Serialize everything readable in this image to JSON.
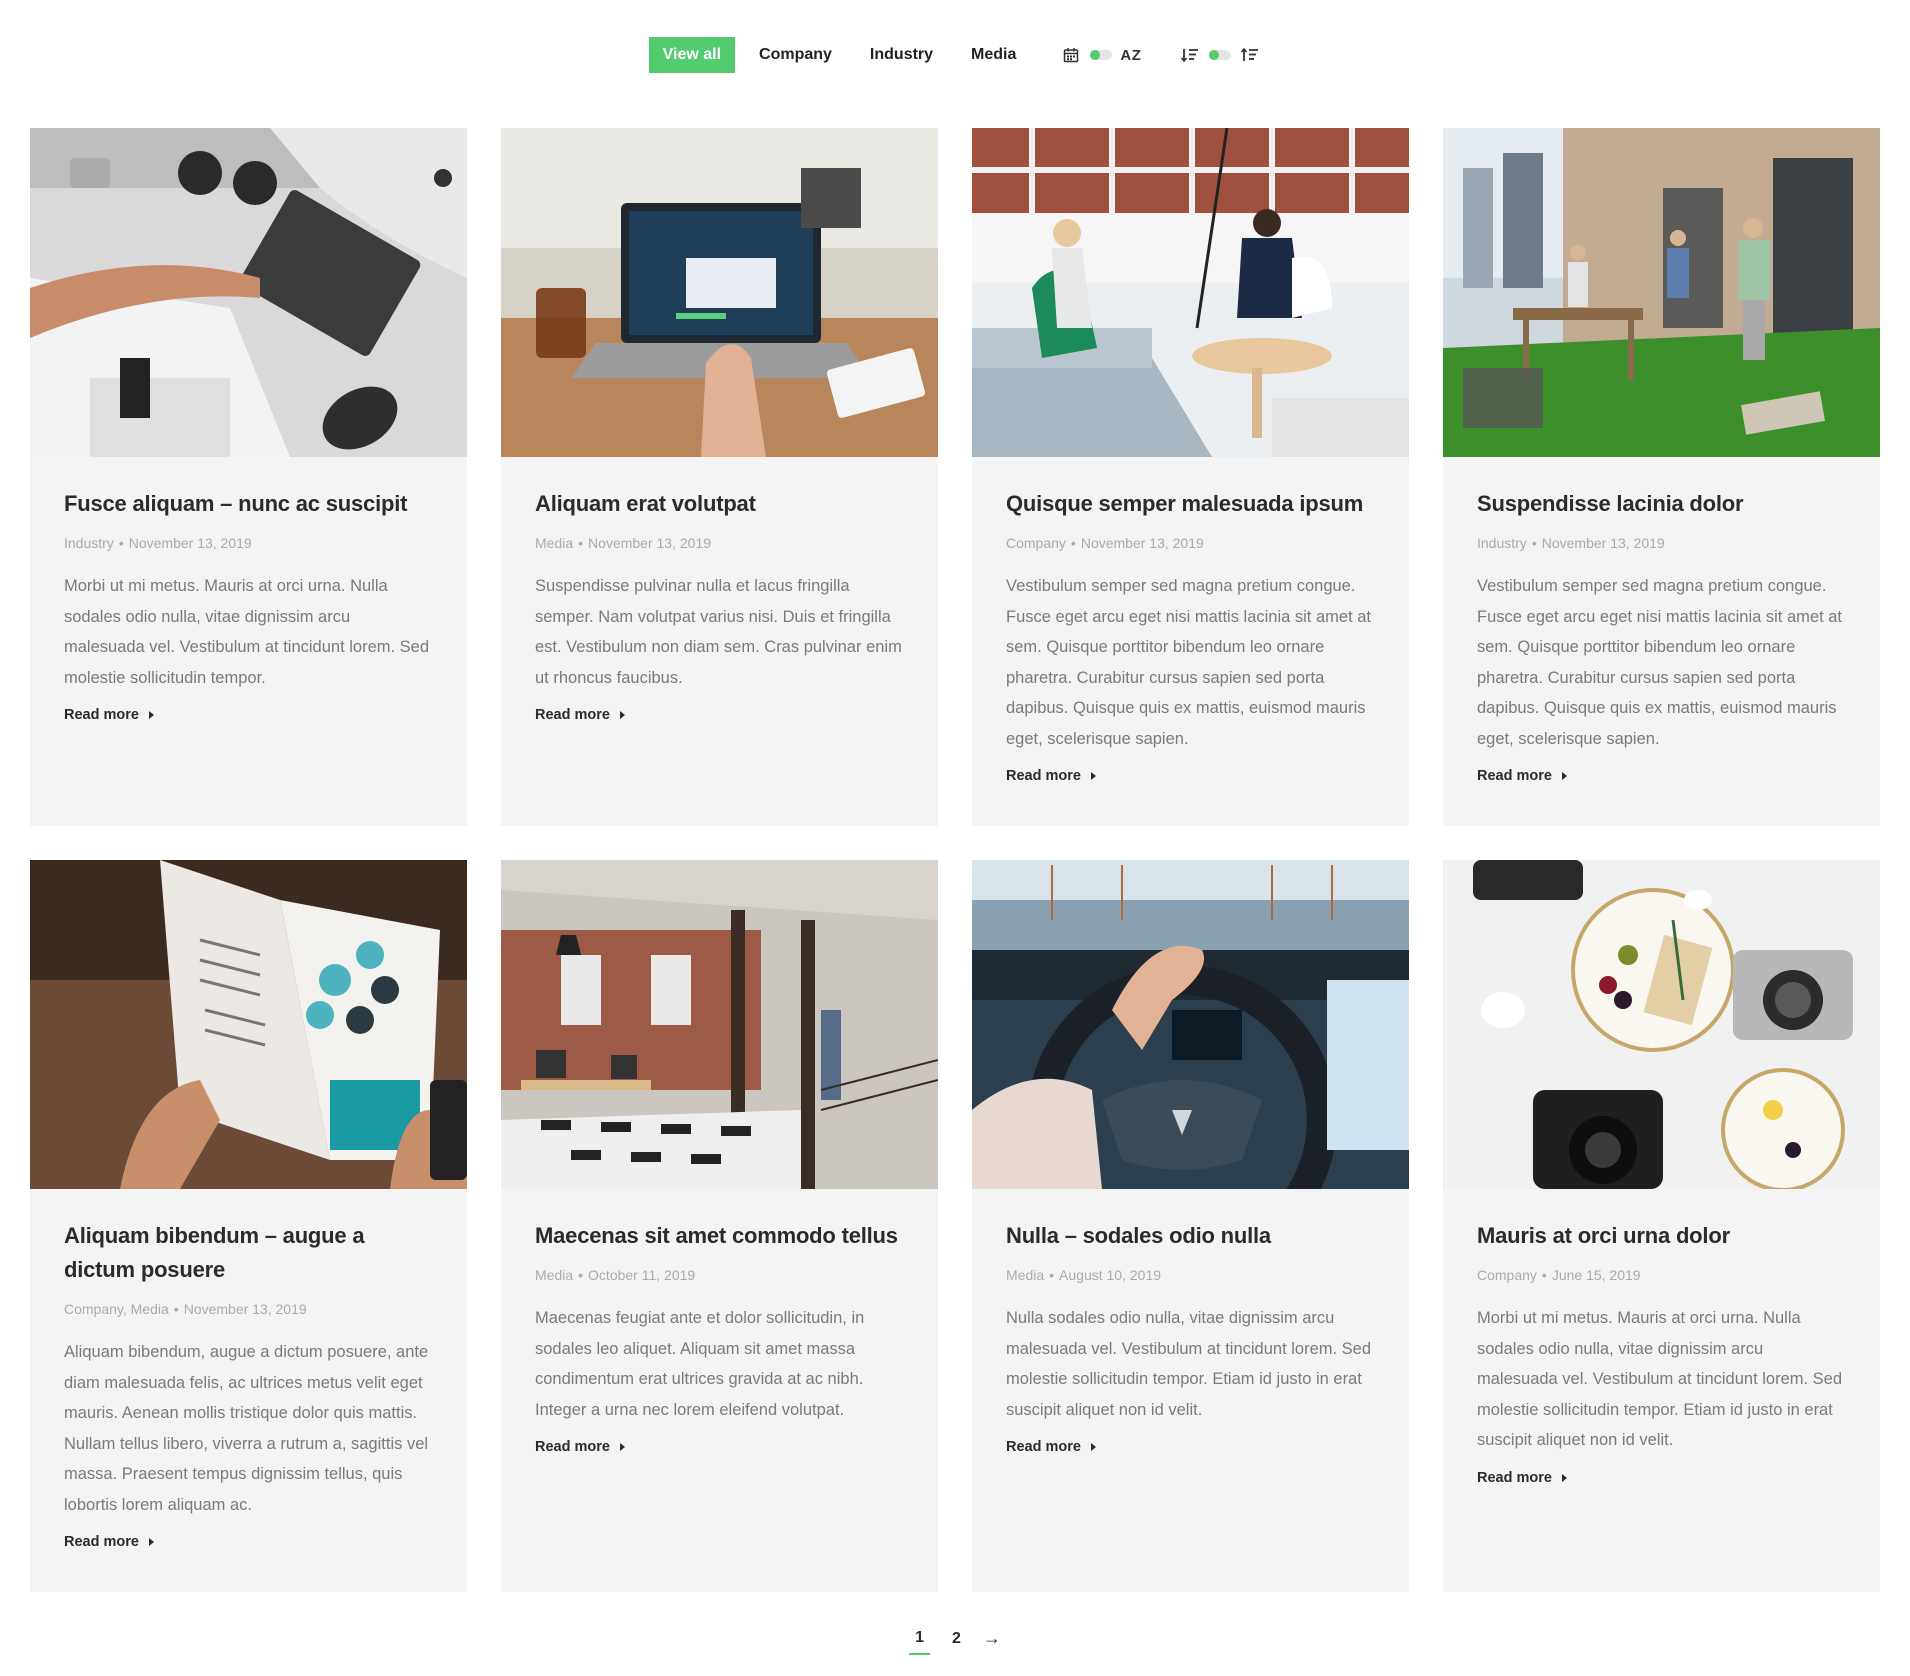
{
  "filters": {
    "buttons": [
      "View all",
      "Company",
      "Industry",
      "Media"
    ],
    "active_index": 0,
    "sort_label": "AZ",
    "accent": "#52cc6f"
  },
  "icons": {
    "date": "calendar-icon",
    "desc": "sort-descending-icon",
    "asc": "sort-ascending-icon",
    "read_more": "caret-right-icon",
    "next": "arrow-right-icon"
  },
  "posts": [
    {
      "title": "Fusce aliquam – nunc ac suscipit",
      "category": "Industry",
      "date": "November 13, 2019",
      "excerpt": "Morbi ut mi metus. Mauris at orci urna. Nulla sodales odio nulla, vitae dignissim arcu malesuada vel. Vestibulum at tincidunt lorem. Sed molestie sollicitudin tempor.",
      "read_more": "Read more"
    },
    {
      "title": "Aliquam erat volutpat",
      "category": "Media",
      "date": "November 13, 2019",
      "excerpt": "Suspendisse pulvinar nulla et lacus fringilla semper. Nam volutpat varius nisi. Duis et fringilla est. Vestibulum non diam sem. Cras pulvinar enim ut rhoncus faucibus.",
      "read_more": "Read more"
    },
    {
      "title": "Quisque semper malesuada ipsum",
      "category": "Company",
      "date": "November 13, 2019",
      "excerpt": "Vestibulum semper sed magna pretium congue. Fusce eget arcu eget nisi mattis lacinia sit amet at sem. Quisque porttitor bibendum leo ornare pharetra. Curabitur cursus sapien sed porta dapibus. Quisque quis ex mattis, euismod mauris eget, scelerisque sapien.",
      "read_more": "Read more"
    },
    {
      "title": "Suspendisse lacinia dolor",
      "category": "Industry",
      "date": "November 13, 2019",
      "excerpt": "Vestibulum semper sed magna pretium congue. Fusce eget arcu eget nisi mattis lacinia sit amet at sem. Quisque porttitor bibendum leo ornare pharetra. Curabitur cursus sapien sed porta dapibus. Quisque quis ex mattis, euismod mauris eget, scelerisque sapien.",
      "read_more": "Read more"
    },
    {
      "title": "Aliquam bibendum – augue a dictum posuere",
      "category": "Company, Media",
      "date": "November 13, 2019",
      "excerpt": "Aliquam bibendum, augue a dictum posuere, ante diam malesuada felis, ac ultrices metus velit eget mauris. Aenean mollis tristique dolor quis mattis. Nullam tellus libero, viverra a rutrum a, sagittis vel massa. Praesent tempus dignissim tellus, quis lobortis lorem aliquam ac.",
      "read_more": "Read more"
    },
    {
      "title": "Maecenas sit amet commodo tellus",
      "category": "Media",
      "date": "October 11, 2019",
      "excerpt": "Maecenas feugiat ante et dolor sollicitudin, in sodales leo aliquet. Aliquam sit amet massa condimentum erat ultrices gravida at ac nibh. Integer a urna nec lorem eleifend volutpat.",
      "read_more": "Read more"
    },
    {
      "title": "Nulla – sodales odio nulla",
      "category": "Media",
      "date": "August 10, 2019",
      "excerpt": "Nulla sodales odio nulla, vitae dignissim arcu malesuada vel. Vestibulum at tincidunt lorem. Sed molestie sollicitudin tempor. Etiam id justo in erat suscipit aliquet non id velit.",
      "read_more": "Read more"
    },
    {
      "title": "Mauris at orci urna dolor",
      "category": "Company",
      "date": "June 15, 2019",
      "excerpt": "Morbi ut mi metus. Mauris at orci urna. Nulla sodales odio nulla, vitae dignissim arcu malesuada vel. Vestibulum at tincidunt lorem. Sed molestie sollicitudin tempor. Etiam id justo in erat suscipit aliquet non id velit.",
      "read_more": "Read more"
    }
  ],
  "pagination": {
    "pages": [
      "1",
      "2"
    ],
    "current": "1",
    "next": "→"
  }
}
